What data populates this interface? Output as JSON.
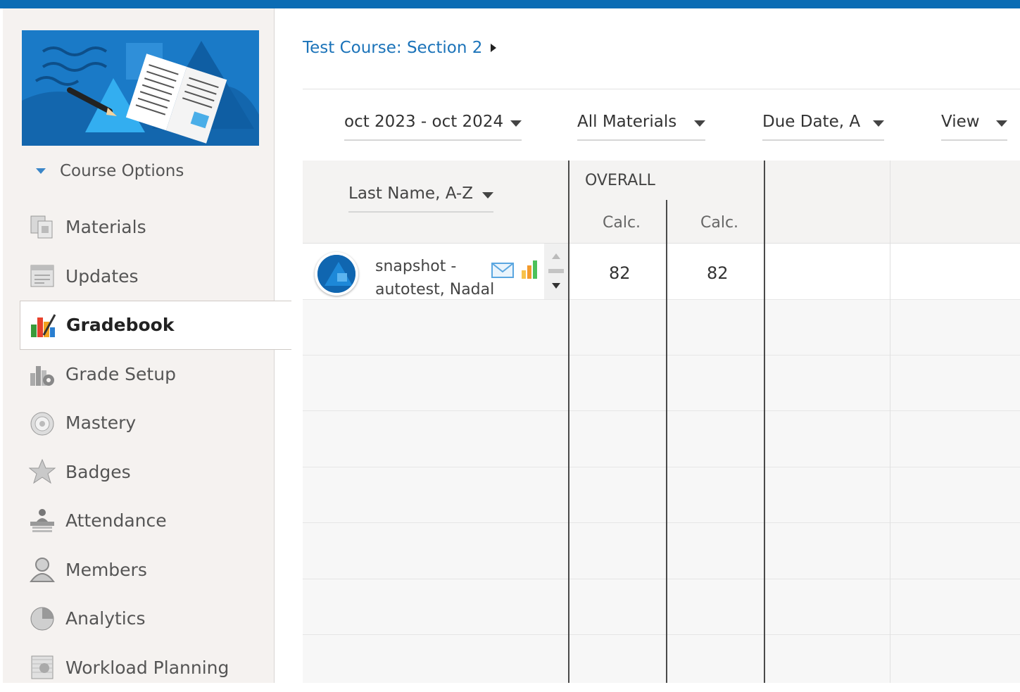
{
  "course": {
    "options_label": "Course Options",
    "breadcrumb": "Test Course: Section 2"
  },
  "sidebar": {
    "items": [
      {
        "label": "Materials",
        "icon": "materials-icon"
      },
      {
        "label": "Updates",
        "icon": "updates-icon"
      },
      {
        "label": "Gradebook",
        "icon": "gradebook-icon",
        "active": true
      },
      {
        "label": "Grade Setup",
        "icon": "grade-setup-icon"
      },
      {
        "label": "Mastery",
        "icon": "mastery-icon"
      },
      {
        "label": "Badges",
        "icon": "badges-icon"
      },
      {
        "label": "Attendance",
        "icon": "attendance-icon"
      },
      {
        "label": "Members",
        "icon": "members-icon"
      },
      {
        "label": "Analytics",
        "icon": "analytics-icon"
      },
      {
        "label": "Workload Planning",
        "icon": "workload-planning-icon"
      }
    ]
  },
  "filters": {
    "date_range": "oct 2023 - oct 2024",
    "materials": "All Materials",
    "sort": "Due Date, A",
    "view": "View"
  },
  "grid": {
    "student_sort": "Last Name, A-Z",
    "overall_label": "OVERALL",
    "columns": [
      "Calc.",
      "Calc."
    ],
    "rows": [
      {
        "name_line1": "snapshot -",
        "name_line2": "autotest, Nadal",
        "scores": [
          "82",
          "82"
        ]
      }
    ]
  },
  "colors": {
    "accent": "#0b6cb4",
    "link": "#1b73b9",
    "sidebar_bg": "#f5f2f0"
  }
}
